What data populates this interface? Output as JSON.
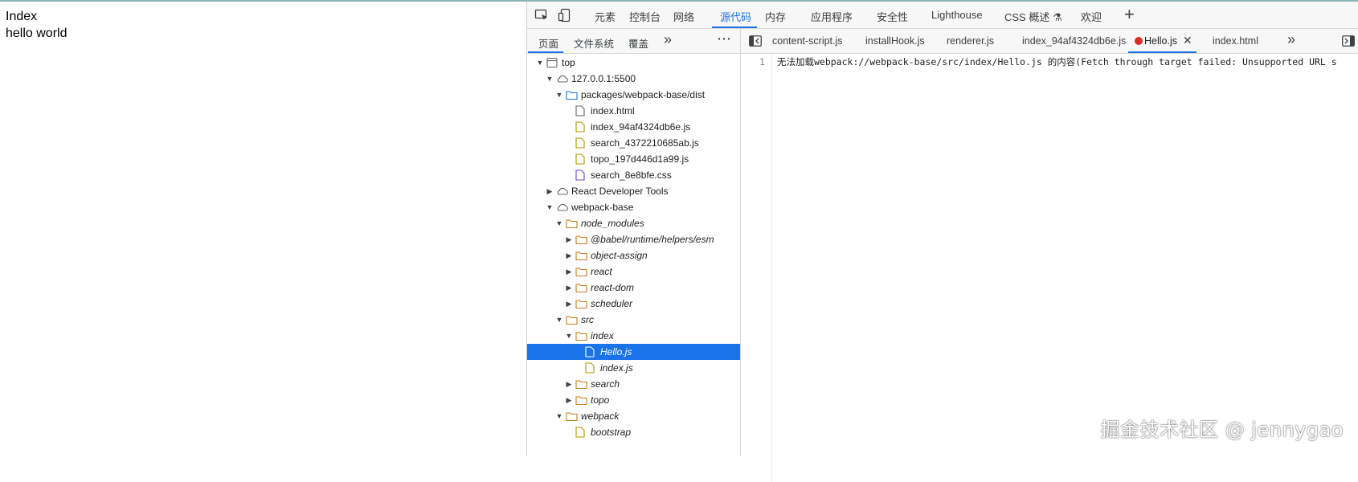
{
  "page": {
    "lines": [
      "Index",
      "hello world"
    ]
  },
  "devtools": {
    "main_tabs": [
      {
        "label": "元素"
      },
      {
        "label": "控制台"
      },
      {
        "label": "网络"
      },
      {
        "label": "源代码",
        "active": true
      },
      {
        "label": "内存"
      },
      {
        "label": "应用程序"
      },
      {
        "label": "安全性"
      },
      {
        "label": "Lighthouse"
      },
      {
        "label": "CSS 概述 ⚗"
      },
      {
        "label": "欢迎"
      }
    ],
    "add_tab_icon": "plus-icon",
    "navigator": {
      "tabs": [
        {
          "label": "页面",
          "active": true
        },
        {
          "label": "文件系统"
        },
        {
          "label": "覆盖"
        }
      ],
      "more_icon": "chevron-double-right-icon",
      "menu_icon": "more-vert-icon"
    },
    "tree": [
      {
        "label": "top",
        "icon": "frame-icon",
        "arrow": "down",
        "depth": 0
      },
      {
        "label": "127.0.0.1:5500",
        "icon": "cloud-icon",
        "arrow": "down",
        "depth": 1
      },
      {
        "label": "packages/webpack-base/dist",
        "icon": "folder-icon-blue",
        "arrow": "down",
        "depth": 2
      },
      {
        "label": "index.html",
        "icon": "file-icon-grey",
        "arrow": "",
        "depth": 3
      },
      {
        "label": "index_94af4324db6e.js",
        "icon": "file-icon-yellow",
        "arrow": "",
        "depth": 3
      },
      {
        "label": "search_4372210685ab.js",
        "icon": "file-icon-yellow",
        "arrow": "",
        "depth": 3
      },
      {
        "label": "topo_197d446d1a99.js",
        "icon": "file-icon-yellow",
        "arrow": "",
        "depth": 3
      },
      {
        "label": "search_8e8bfe.css",
        "icon": "file-icon-purple",
        "arrow": "",
        "depth": 3
      },
      {
        "label": "React Developer Tools",
        "icon": "cloud-icon",
        "arrow": "right",
        "depth": 1
      },
      {
        "label": "webpack-base",
        "icon": "cloud-icon",
        "arrow": "down",
        "depth": 1
      },
      {
        "label": "node_modules",
        "icon": "folder-icon-orange",
        "arrow": "down",
        "depth": 2,
        "italic": true
      },
      {
        "label": "@babel/runtime/helpers/esm",
        "icon": "folder-icon-orange",
        "arrow": "right",
        "depth": 3,
        "italic": true
      },
      {
        "label": "object-assign",
        "icon": "folder-icon-orange",
        "arrow": "right",
        "depth": 3,
        "italic": true
      },
      {
        "label": "react",
        "icon": "folder-icon-orange",
        "arrow": "right",
        "depth": 3,
        "italic": true
      },
      {
        "label": "react-dom",
        "icon": "folder-icon-orange",
        "arrow": "right",
        "depth": 3,
        "italic": true
      },
      {
        "label": "scheduler",
        "icon": "folder-icon-orange",
        "arrow": "right",
        "depth": 3,
        "italic": true
      },
      {
        "label": "src",
        "icon": "folder-icon-orange",
        "arrow": "down",
        "depth": 2,
        "italic": true
      },
      {
        "label": "index",
        "icon": "folder-icon-orange",
        "arrow": "down",
        "depth": 3,
        "italic": true
      },
      {
        "label": "Hello.js",
        "icon": "file-icon-yellow",
        "arrow": "",
        "depth": 4,
        "italic": true,
        "selected": true
      },
      {
        "label": "index.js",
        "icon": "file-icon-yellow",
        "arrow": "",
        "depth": 4,
        "italic": true
      },
      {
        "label": "search",
        "icon": "folder-icon-orange",
        "arrow": "right",
        "depth": 3,
        "italic": true
      },
      {
        "label": "topo",
        "icon": "folder-icon-orange",
        "arrow": "right",
        "depth": 3,
        "italic": true
      },
      {
        "label": "webpack",
        "icon": "folder-icon-orange",
        "arrow": "down",
        "depth": 2,
        "italic": true
      },
      {
        "label": "bootstrap",
        "icon": "file-icon-yellow",
        "arrow": "",
        "depth": 3,
        "italic": true
      }
    ],
    "editor": {
      "toggle_icon": "sidebar-toggle-icon",
      "tabs": [
        {
          "label": "content-script.js"
        },
        {
          "label": "installHook.js"
        },
        {
          "label": "renderer.js"
        },
        {
          "label": "index_94af4324db6e.js"
        },
        {
          "label": "Hello.js",
          "active": true,
          "error": true,
          "closable": true
        },
        {
          "label": "index.html"
        }
      ],
      "more_icon": "chevron-double-right-icon",
      "right_toggle_icon": "sidebar-toggle-right-icon",
      "line_number": "1",
      "code": "无法加载webpack://webpack-base/src/index/Hello.js 的内容(Fetch through target failed: Unsupported URL s"
    }
  },
  "watermark": "掘金技术社区 @ jennygao"
}
